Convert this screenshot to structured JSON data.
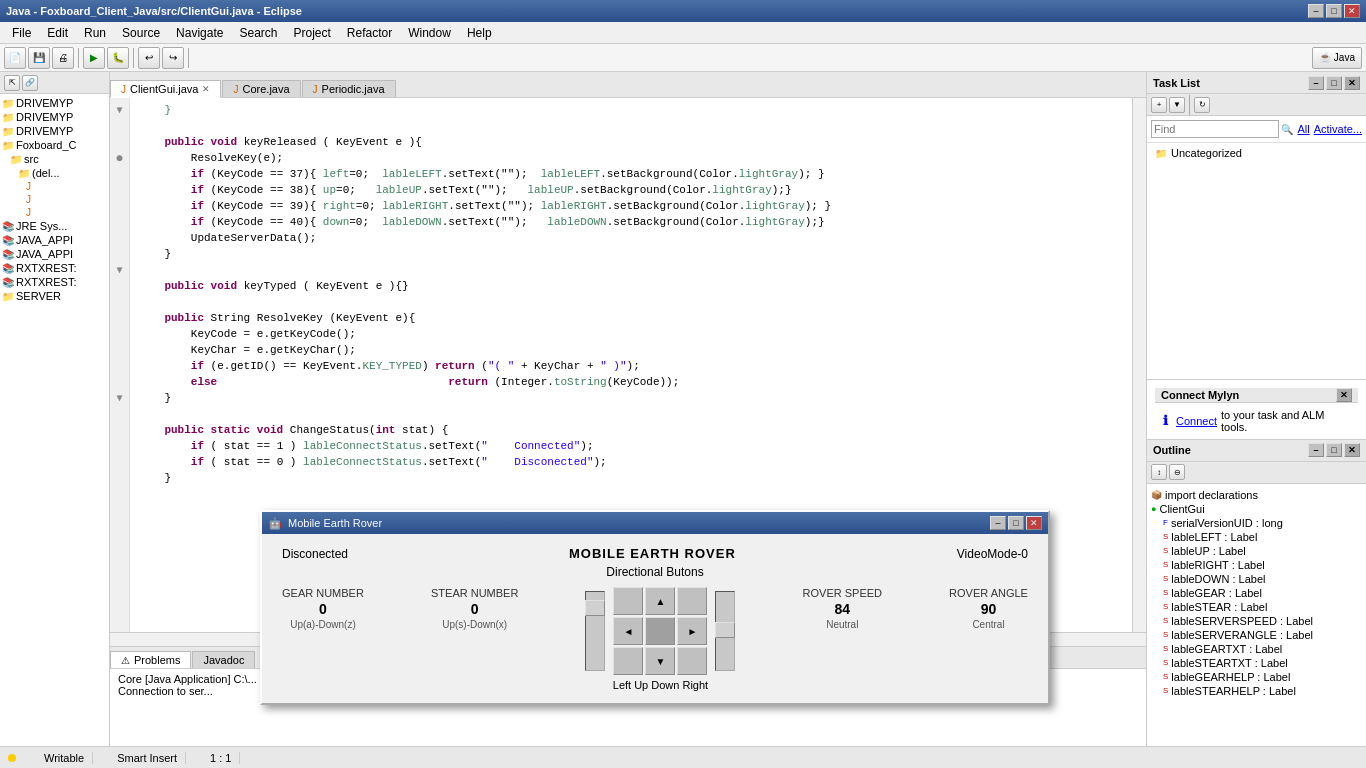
{
  "titlebar": {
    "title": "Java - Foxboard_Client_Java/src/ClientGui.java - Eclipse",
    "minimize": "–",
    "maximize": "□",
    "close": "✕"
  },
  "menubar": {
    "items": [
      "File",
      "Edit",
      "Run",
      "Source",
      "Navigate",
      "Search",
      "Project",
      "Refactor",
      "Window",
      "Help"
    ]
  },
  "editor": {
    "tabs": [
      {
        "label": "ClientGui.java",
        "active": true
      },
      {
        "label": "Core.java",
        "active": false
      },
      {
        "label": "Periodic.java",
        "active": false
      }
    ],
    "code_lines": [
      {
        "num": "",
        "fold": ""
      },
      {
        "num": "",
        "fold": ""
      },
      {
        "num": "",
        "fold": "▼"
      },
      {
        "num": "",
        "fold": ""
      },
      {
        "num": "",
        "fold": ""
      },
      {
        "num": "",
        "fold": ""
      },
      {
        "num": "",
        "fold": ""
      },
      {
        "num": "",
        "fold": ""
      },
      {
        "num": "",
        "fold": ""
      },
      {
        "num": "",
        "fold": ""
      },
      {
        "num": "",
        "fold": "▼"
      },
      {
        "num": "",
        "fold": ""
      },
      {
        "num": "",
        "fold": ""
      },
      {
        "num": "",
        "fold": ""
      },
      {
        "num": "",
        "fold": ""
      },
      {
        "num": "",
        "fold": ""
      },
      {
        "num": "",
        "fold": ""
      },
      {
        "num": "",
        "fold": ""
      },
      {
        "num": "",
        "fold": ""
      },
      {
        "num": "",
        "fold": ""
      },
      {
        "num": "",
        "fold": "▼"
      }
    ]
  },
  "tasklist": {
    "title": "Task List",
    "find_placeholder": "Find",
    "all_label": "All",
    "activate_label": "Activate...",
    "uncategorized": "Uncategorized"
  },
  "connect_mylyn": {
    "title": "Connect Mylyn",
    "connect_label": "Connect",
    "description": "to your task and ALM tools."
  },
  "outline": {
    "title": "Outline",
    "items": [
      {
        "label": "import declarations",
        "indent": 0,
        "type": "imports"
      },
      {
        "label": "ClientGui",
        "indent": 0,
        "type": "class"
      },
      {
        "label": "serialVersionUID : long",
        "indent": 1,
        "type": "field"
      },
      {
        "label": "lableLEFT : Label",
        "indent": 1,
        "type": "field"
      },
      {
        "label": "lableUP : Label",
        "indent": 1,
        "type": "field"
      },
      {
        "label": "lableRIGHT : Label",
        "indent": 1,
        "type": "field"
      },
      {
        "label": "lableDOWN : Label",
        "indent": 1,
        "type": "field"
      },
      {
        "label": "lableGEAR : Label",
        "indent": 1,
        "type": "field"
      },
      {
        "label": "lableSTEAR : Label",
        "indent": 1,
        "type": "field"
      },
      {
        "label": "lableSERVERSPEED : Label",
        "indent": 1,
        "type": "field"
      },
      {
        "label": "lableSERVERANGLE : Label",
        "indent": 1,
        "type": "field"
      },
      {
        "label": "lableGEARTXT : Label",
        "indent": 1,
        "type": "field"
      },
      {
        "label": "lableSTEARTXT : Label",
        "indent": 1,
        "type": "field"
      },
      {
        "label": "lableGEARHELP : Label",
        "indent": 1,
        "type": "field"
      },
      {
        "label": "lableSTEARHELP : Label",
        "indent": 1,
        "type": "field"
      }
    ]
  },
  "bottom_panel": {
    "tabs": [
      "Problems",
      "Javadoc"
    ],
    "content_lines": [
      "Core [Java Application] C:\\...",
      "Connection to ser..."
    ]
  },
  "statusbar": {
    "writable": "Writable",
    "smart_insert": "Smart Insert",
    "position": "1 : 1"
  },
  "modal": {
    "title": "Mobile Earth Rover",
    "icon": "🤖",
    "status_left": "Disconected",
    "rover_title": "MOBILE EARTH ROVER",
    "video_mode": "VideoMode-0",
    "subtitle": "Directional Butons",
    "gear_label": "GEAR NUMBER",
    "stear_label": "STEAR NUMBER",
    "gear_value": "0",
    "stear_value": "0",
    "gear_sub": "Up(a)-Down(z)",
    "stear_sub": "Up(s)-Down(x)",
    "dir_label": "Left Up Down Right",
    "speed_label": "ROVER SPEED",
    "angle_label": "ROVER ANGLE",
    "speed_value": "84",
    "angle_value": "90",
    "speed_sub": "Neutral",
    "angle_sub": "Central"
  },
  "file_tree": {
    "items": [
      {
        "label": "DRIVEMYP...",
        "indent": 0,
        "icon": "📁"
      },
      {
        "label": "DRIVEMYP...",
        "indent": 0,
        "icon": "📁"
      },
      {
        "label": "DRIVEMYP...",
        "indent": 0,
        "icon": "📁"
      },
      {
        "label": "Foxboard_C...",
        "indent": 0,
        "icon": "📁"
      },
      {
        "label": "src",
        "indent": 1,
        "icon": "📁"
      },
      {
        "label": "(del...",
        "indent": 2,
        "icon": "📁"
      },
      {
        "label": "J",
        "indent": 3,
        "icon": "📄"
      },
      {
        "label": "J",
        "indent": 3,
        "icon": "📄"
      },
      {
        "label": "J",
        "indent": 3,
        "icon": "📄"
      },
      {
        "label": "JRE Sys...",
        "indent": 0,
        "icon": "📚"
      },
      {
        "label": "JAVA_APPI...",
        "indent": 0,
        "icon": "📚"
      },
      {
        "label": "JAVA_APPI...",
        "indent": 0,
        "icon": "📚"
      },
      {
        "label": "RXTXREST:...",
        "indent": 0,
        "icon": "📚"
      },
      {
        "label": "RXTXREST:...",
        "indent": 0,
        "icon": "📚"
      },
      {
        "label": "SERVER",
        "indent": 0,
        "icon": "📁"
      }
    ]
  }
}
